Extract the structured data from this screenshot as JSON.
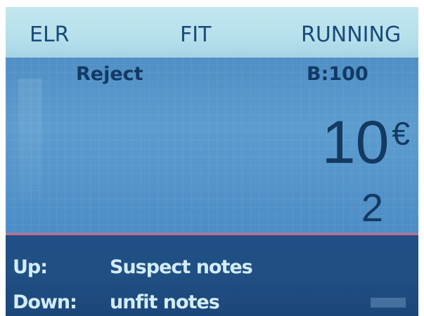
{
  "topbar": {
    "mode": "ELR",
    "fit": "FIT",
    "status": "RUNNING"
  },
  "main": {
    "reject": "Reject",
    "batch": "B:100",
    "denomination_value": "10",
    "denomination_currency": "€",
    "count": "2"
  },
  "help": {
    "up_key": "Up:",
    "up_text": "Suspect notes",
    "down_key": "Down:",
    "down_text": "unfit notes"
  },
  "colors": {
    "topbar_bg": "#b6e0ec",
    "main_bg": "#5a96c8",
    "separator": "#c86a8a",
    "help_bg": "#1f4f86",
    "main_text": "#143a62",
    "help_text": "#d2ecfa"
  }
}
